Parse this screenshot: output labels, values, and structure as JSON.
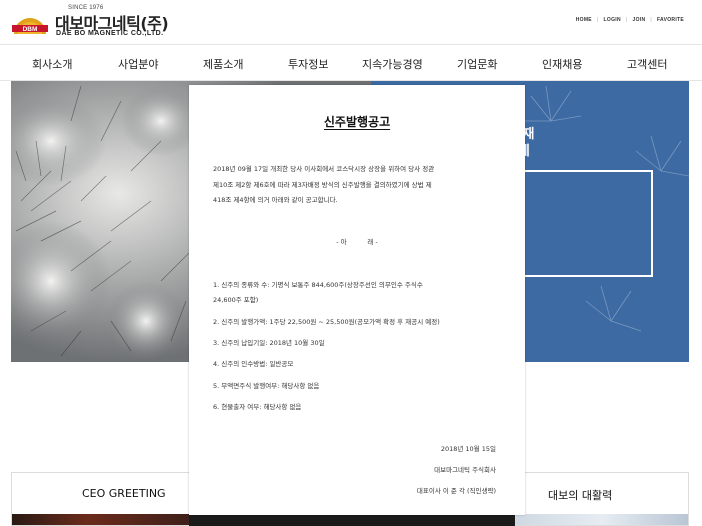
{
  "header": {
    "logo": {
      "since": "SINCE 1976",
      "name_kr": "대보마그네틱(주)",
      "name_en": "DAE BO MAGNETIC CO.,LTD.",
      "mark_text": "DBM",
      "mark_color": "#e0a21b"
    },
    "util_links": [
      "HOME",
      "LOGIN",
      "JOIN",
      "FAVORITE"
    ],
    "util_separator": "|"
  },
  "nav": {
    "items": [
      "회사소개",
      "사업분야",
      "제품소개",
      "투자정보",
      "지속가능경영",
      "기업문화",
      "인재채용",
      "고객센터"
    ]
  },
  "hero": {
    "text_lines": [
      "리 소재",
      "조업체"
    ],
    "right_color": "#3d6aa3"
  },
  "cards": {
    "left_title": "CEO GREETING",
    "right_title": "대보의 대활력"
  },
  "popup": {
    "title": "신주발행공고",
    "intro": [
      "2018년 09월 17일 개최한 당사 이사회에서 코스닥시장 상장을 위하여 당사 정관",
      "제10조 제2항 제6호에 따라 제3자배정 방식의 신주발행을 결의하였기에 상법 제",
      "418조 제4항에 의거 아래와 같이 공고합니다."
    ],
    "below": "- 아          래 -",
    "items": [
      [
        "1.  신주의 종류와 수: 기명식 보통주 844,600주(상장주선인 의무인수 주식수",
        "24,600주 포함)"
      ],
      [
        "2.  신주의 발행가액: 1주당 22,500원 ~ 25,500원(공모가액 확정 후 재공시 예정)"
      ],
      [
        "3.  신주의 납입기일: 2018년 10월 30일"
      ],
      [
        "4.  신주의 인수방법: 일반공모"
      ],
      [
        "5.  무액면주식 발행여부: 해당사항 없음"
      ],
      [
        "6.  현물출자 여부: 해당사항 없음"
      ]
    ],
    "date": "2018년 10월 15일",
    "company": "대보마그네틱 주식회사",
    "ceo": "대표이사 이 준 각 (직인생략)"
  }
}
